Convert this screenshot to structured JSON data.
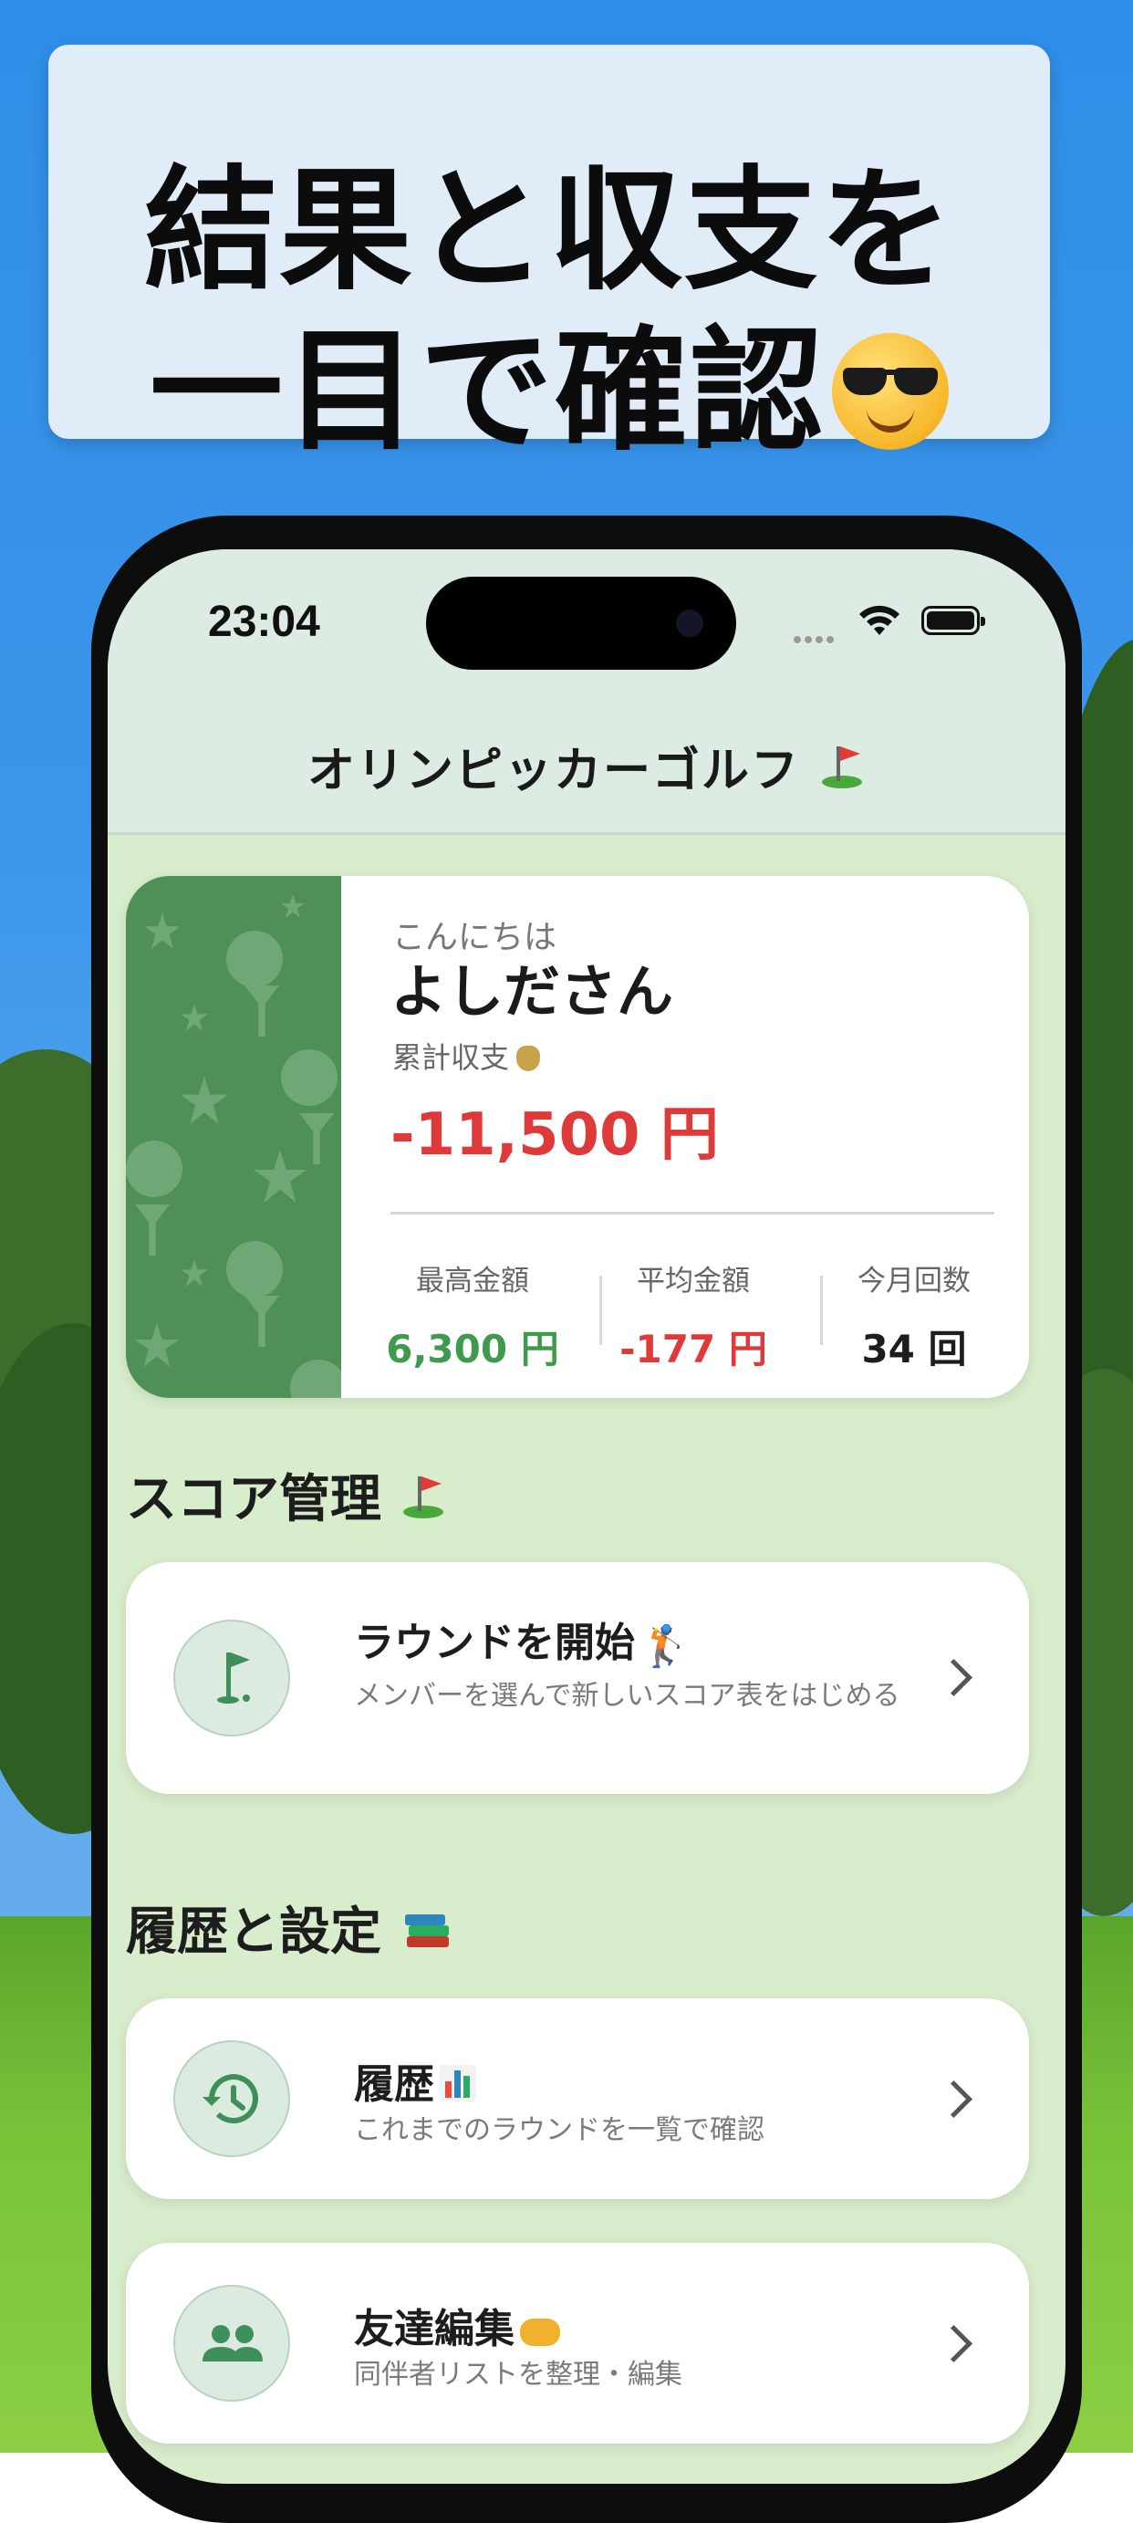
{
  "banner": {
    "line1": "結果と収支を",
    "line2": "一目で確認"
  },
  "status_bar": {
    "time": "23:04"
  },
  "app": {
    "title": "オリンピッカーゴルフ"
  },
  "profile": {
    "greeting": "こんにちは",
    "name": "よしださん",
    "total_label": "累計収支",
    "total_value": "-11,500 円",
    "stats": [
      {
        "label": "最高金額",
        "value": "6,300 円",
        "color": "#3f9a4e"
      },
      {
        "label": "平均金額",
        "value": "-177 円",
        "color": "#df3a3a"
      },
      {
        "label": "今月回数",
        "value": "34 回",
        "color": "#1d1d1d"
      }
    ]
  },
  "score_section": {
    "title": "スコア管理",
    "start_round": {
      "title": "ラウンドを開始",
      "subtitle": "メンバーを選んで新しいスコア表をはじめる",
      "icon": "golf-flag-icon"
    }
  },
  "history_section": {
    "title": "履歴と設定",
    "history": {
      "title": "履歴",
      "subtitle": "これまでのラウンドを一覧で確認",
      "icon": "history-icon"
    },
    "friends": {
      "title": "友達編集",
      "subtitle": "同伴者リストを整理・編集",
      "icon": "people-icon"
    }
  },
  "colors": {
    "accent_green": "#3f9a4e",
    "negative_red": "#df3a3a",
    "screen_bg": "#d8edcc"
  }
}
